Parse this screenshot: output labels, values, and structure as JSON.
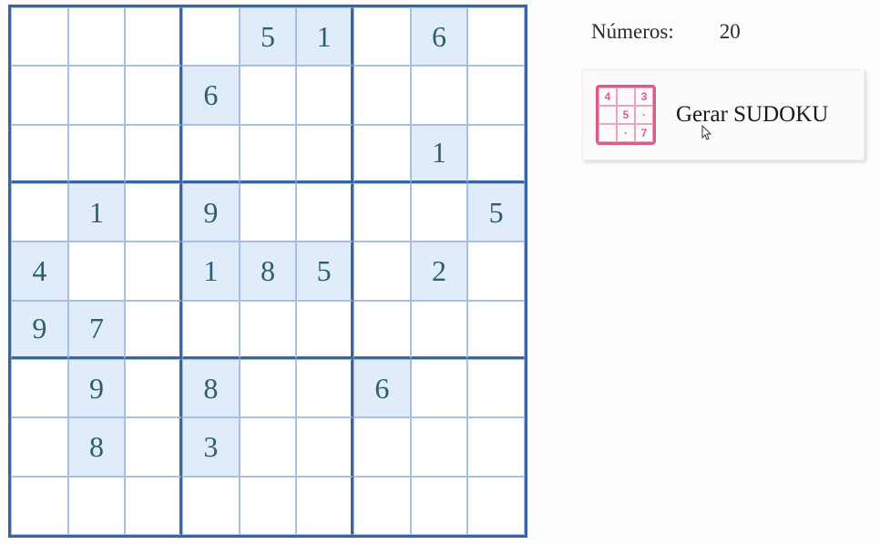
{
  "sudoku": {
    "grid": [
      [
        "",
        "",
        "",
        "",
        "5",
        "1",
        "",
        "6",
        ""
      ],
      [
        "",
        "",
        "",
        "6",
        "",
        "",
        "",
        "",
        ""
      ],
      [
        "",
        "",
        "",
        "",
        "",
        "",
        "",
        "1",
        ""
      ],
      [
        "",
        "1",
        "",
        "9",
        "",
        "",
        "",
        "",
        "5"
      ],
      [
        "4",
        "",
        "",
        "1",
        "8",
        "5",
        "",
        "2",
        ""
      ],
      [
        "9",
        "7",
        "",
        "",
        "",
        "",
        "",
        "",
        ""
      ],
      [
        "",
        "9",
        "",
        "8",
        "",
        "",
        "6",
        "",
        ""
      ],
      [
        "",
        "8",
        "",
        "3",
        "",
        "",
        "",
        "",
        ""
      ],
      [
        "",
        "",
        "",
        "",
        "",
        "",
        "",
        "",
        ""
      ]
    ]
  },
  "sidebar": {
    "numeros_label": "Números:",
    "numeros_value": "20",
    "generate_label": "Gerar SUDOKU",
    "icon_cells": [
      "4",
      "",
      "3",
      "",
      "5",
      "·",
      "",
      "·",
      "7"
    ]
  }
}
